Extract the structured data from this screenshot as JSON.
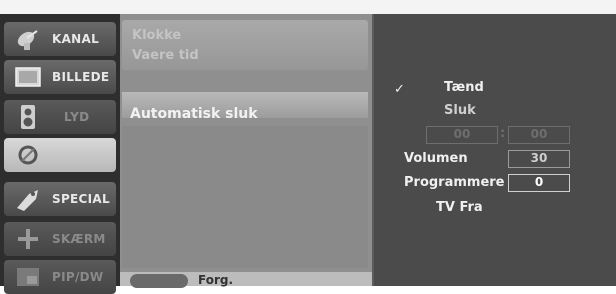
{
  "sidebar": {
    "items": [
      {
        "label": "KANAL",
        "icon": "satellite-dish-icon"
      },
      {
        "label": "BILLEDE",
        "icon": "picture-frame-icon"
      },
      {
        "label": "LYD",
        "icon": "speaker-icon"
      },
      {
        "label": "",
        "icon": "clock-icon"
      },
      {
        "label": "SPECIAL",
        "icon": "tag-icon"
      },
      {
        "label": "SKÆRM",
        "icon": "arrows-move-icon"
      },
      {
        "label": "PIP/DW",
        "icon": "pip-icon"
      }
    ]
  },
  "middle": {
    "faded_1": "Klokke",
    "faded_2": "Vaere tid",
    "selected_label": "Automatisk  sluk",
    "bottom_hint": "Forg."
  },
  "right": {
    "check": "✓",
    "on": "Tænd",
    "off": "Sluk",
    "hour": "00",
    "colon": ":",
    "minute": "00",
    "volume_label": "Volumen",
    "volume_value": "30",
    "program_label": "Programmere",
    "program_value": "0",
    "tv_from": "TV Fra"
  }
}
